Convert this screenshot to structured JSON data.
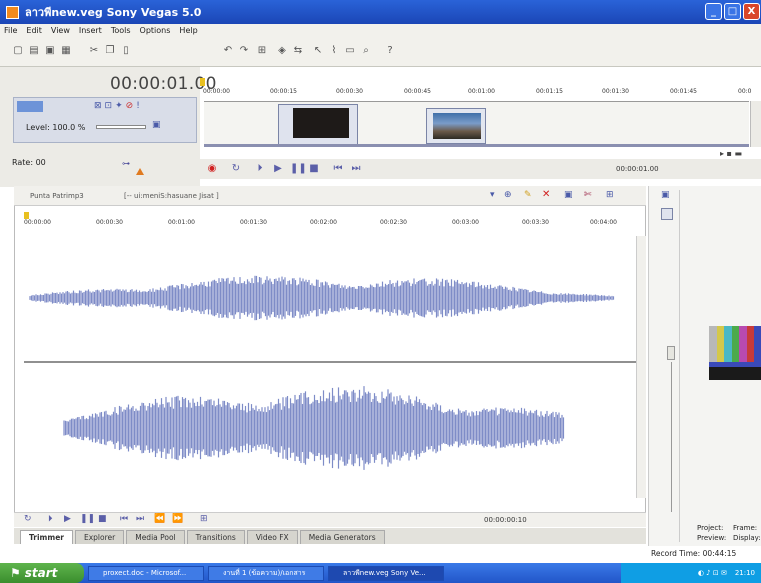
{
  "window": {
    "title": "ลาวพีnew.veg   Sony Vegas 5.0",
    "controls": {
      "minimize": "_",
      "maximize": "□",
      "close": "X"
    }
  },
  "menu": [
    "File",
    "Edit",
    "View",
    "Insert",
    "Tools",
    "Options",
    "Help"
  ],
  "timeline": {
    "timecode": "00:00:01.00",
    "level_label": "Level: 100.0 %",
    "rate_label": "Rate: 00",
    "ruler_ticks": [
      "00:00:00",
      "00:00:15",
      "00:00:30",
      "00:00:45",
      "00:01:00",
      "00:01:15",
      "00:01:30",
      "00:01:45",
      "00:0"
    ],
    "transport_timecode": "00:00:01.00"
  },
  "trimmer": {
    "tabs": [
      "Punta Patrimp3",
      "[-- ui:meniS:hasuane Jisat ]"
    ],
    "ruler_ticks": [
      "00:00:00",
      "00:00:30",
      "00:01:00",
      "00:01:30",
      "00:02:00",
      "00:02:30",
      "00:03:00",
      "00:03:30",
      "00:04:00"
    ],
    "timecode": "00:00:00:10"
  },
  "bottom_tabs": [
    "Trimmer",
    "Explorer",
    "Media Pool",
    "Transitions",
    "Video FX",
    "Media Generators"
  ],
  "side_panel": {
    "labels": [
      "Project:",
      "Frame:",
      "Preview:",
      "Display:"
    ],
    "record_time": "Record Time: 00:44:15"
  },
  "taskbar": {
    "start_label": "start",
    "tasks": [
      "proxect.doc - Microsof...",
      "งานที่ 1 (ข้อความ)/เอกสาร",
      "ลาวพีnew.veg  Sony Ve..."
    ],
    "clock": "21:10"
  },
  "colors": {
    "waveform": "#7e8cc7",
    "title_bar": "#2a63d8",
    "taskbar": "#2e6be0"
  }
}
